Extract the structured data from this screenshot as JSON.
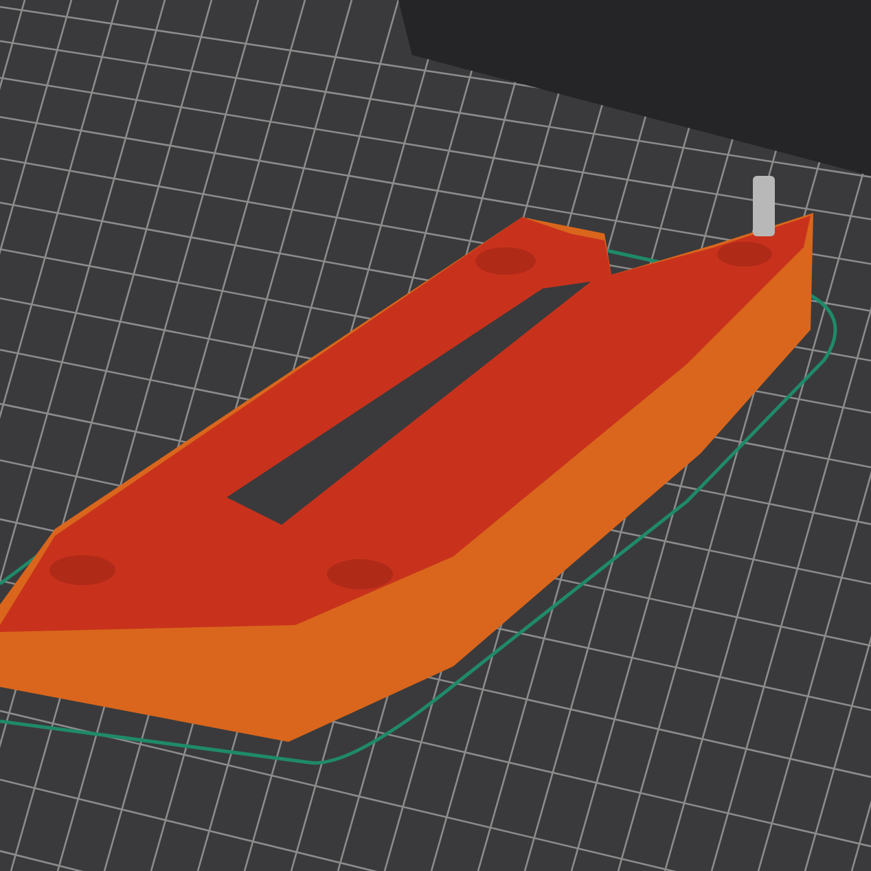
{
  "preview": {
    "skirt": true
  }
}
